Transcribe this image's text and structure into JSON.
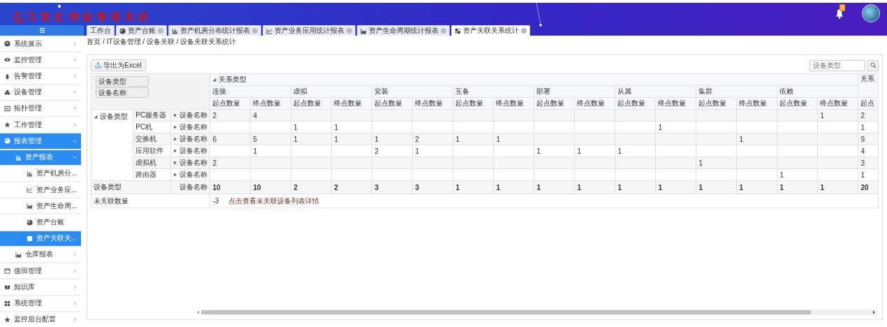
{
  "header": {
    "logo_text": "万里红网络管理系统",
    "notification_count": "0"
  },
  "tabs": [
    {
      "label": "工作台",
      "kind": "none",
      "closable": false,
      "selected": false
    },
    {
      "label": "资产台账",
      "kind": "pie",
      "closable": true,
      "selected": false
    },
    {
      "label": "资产机房分布统计报表",
      "kind": "bar",
      "closable": true,
      "selected": false
    },
    {
      "label": "资产业务应用统计报表",
      "kind": "line",
      "closable": true,
      "selected": false
    },
    {
      "label": "资产生命周期统计报表",
      "kind": "area",
      "closable": true,
      "selected": false
    },
    {
      "label": "资产关联关系统计",
      "kind": "tiles",
      "closable": true,
      "selected": true
    }
  ],
  "sidebar": {
    "items": [
      {
        "label": "系统展示",
        "kind": "globe",
        "expanded": false
      },
      {
        "label": "监控管理",
        "kind": "eye",
        "expanded": false
      },
      {
        "label": "告警管理",
        "kind": "bell",
        "expanded": false
      },
      {
        "label": "设备管理",
        "kind": "share",
        "expanded": false
      },
      {
        "label": "拓扑管理",
        "kind": "frame",
        "expanded": false
      },
      {
        "label": "工作管理",
        "kind": "star",
        "expanded": false
      },
      {
        "label": "报表管理",
        "kind": "pie",
        "expanded": true,
        "children": [
          {
            "label": "资产报表",
            "kind": "bar",
            "expanded": true,
            "children": [
              {
                "label": "资产机房分...",
                "kind": "bar",
                "selected": false
              },
              {
                "label": "资产业务应...",
                "kind": "line",
                "selected": false
              },
              {
                "label": "资产生命周...",
                "kind": "area",
                "selected": false
              },
              {
                "label": "资产台账",
                "kind": "pie",
                "selected": false
              },
              {
                "label": "资产关联关...",
                "kind": "tiles",
                "selected": true
              }
            ]
          },
          {
            "label": "仓库报表",
            "kind": "area",
            "expanded": false
          }
        ]
      },
      {
        "label": "值班管理",
        "kind": "calendar",
        "expanded": false
      },
      {
        "label": "知识库",
        "kind": "book",
        "expanded": false
      },
      {
        "label": "系统管理",
        "kind": "grid",
        "expanded": false
      },
      {
        "label": "监控后台配置",
        "kind": "star",
        "expanded": false
      }
    ]
  },
  "breadcrumb": "首页 / IT设备管理 / 设备关联 / 设备关联关系统计",
  "toolbar": {
    "export_button": "导出为Excel",
    "search": {
      "placeholder": "设备类型"
    }
  },
  "pivot": {
    "filters": [
      "设备类型",
      "设备名称"
    ],
    "column_dimension": {
      "label": "关系类型",
      "expanded": true
    },
    "column_groups": [
      {
        "label": "连接",
        "subcolumns": [
          "起点数量",
          "终点数量"
        ]
      },
      {
        "label": "虚拟",
        "subcolumns": [
          "起点数量",
          "终点数量"
        ]
      },
      {
        "label": "安装",
        "subcolumns": [
          "起点数量",
          "终点数量"
        ]
      },
      {
        "label": "互备",
        "subcolumns": [
          "起点数量",
          "终点数量"
        ]
      },
      {
        "label": "部署",
        "subcolumns": [
          "起点数量",
          "终点数量"
        ]
      },
      {
        "label": "从属",
        "subcolumns": [
          "起点数量",
          "终点数量"
        ]
      },
      {
        "label": "集群",
        "subcolumns": [
          "起点数量",
          "终点数量"
        ]
      },
      {
        "label": "依赖",
        "subcolumns": [
          "起点数量",
          "终点数量"
        ]
      }
    ],
    "total_column": {
      "label": "关系",
      "subcolumn": "起点"
    },
    "row_dimension": {
      "label": "设备类型",
      "expanded": true
    },
    "rows": [
      {
        "type": "PC服务器",
        "name_field": "设备名称",
        "expanded": false,
        "values": {
          "col_1": "2",
          "col_2": "4",
          "col_16": "1",
          "col_17": "2"
        }
      },
      {
        "type": "PC机",
        "name_field": "设备名称",
        "expanded": false,
        "values": {
          "col_3": "1",
          "col_4": "1",
          "col_12": "1",
          "col_17": "1"
        }
      },
      {
        "type": "交换机",
        "name_field": "设备名称",
        "expanded": false,
        "values": {
          "col_1": "6",
          "col_2": "5",
          "col_3": "1",
          "col_4": "1",
          "col_5": "1",
          "col_6": "2",
          "col_7": "1",
          "col_8": "1",
          "col_14": "1",
          "col_17": "9"
        }
      },
      {
        "type": "应用软件",
        "name_field": "设备名称",
        "expanded": false,
        "values": {
          "col_2": "1",
          "col_5": "2",
          "col_6": "1",
          "col_9": "1",
          "col_10": "1",
          "col_11": "1",
          "col_17": "4"
        }
      },
      {
        "type": "虚拟机",
        "name_field": "设备名称",
        "expanded": false,
        "values": {
          "col_1": "2",
          "col_13": "1",
          "col_17": "3"
        }
      },
      {
        "type": "路由器",
        "name_field": "设备名称",
        "expanded": false,
        "values": {
          "col_15": "1",
          "col_17": "1"
        }
      }
    ],
    "totals": {
      "label_1": "设备类型",
      "label_2": "设备名称",
      "values": [
        "10",
        "10",
        "2",
        "2",
        "3",
        "3",
        "1",
        "1",
        "1",
        "1",
        "1",
        "1",
        "1",
        "1",
        "1",
        "1",
        "20"
      ]
    },
    "unlinked": {
      "label": "未关联数量",
      "count": "-3",
      "link": "点击查看未关联设备列表详情"
    }
  }
}
